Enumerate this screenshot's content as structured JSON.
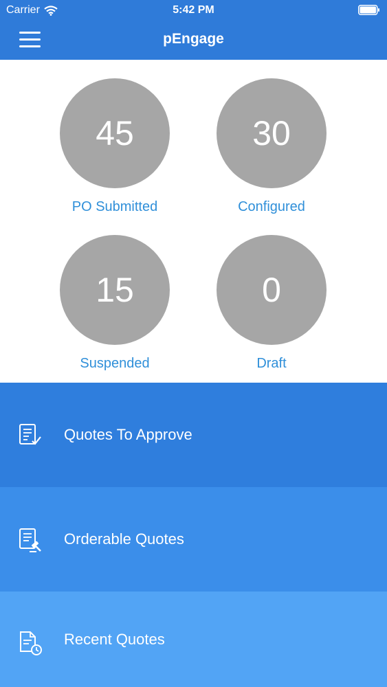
{
  "status_bar": {
    "carrier": "Carrier",
    "time": "5:42 PM"
  },
  "header": {
    "title": "pEngage"
  },
  "stats": [
    {
      "value": "45",
      "label": "PO Submitted"
    },
    {
      "value": "30",
      "label": "Configured"
    },
    {
      "value": "15",
      "label": "Suspended"
    },
    {
      "value": "0",
      "label": "Draft"
    }
  ],
  "menu": [
    {
      "label": "Quotes To Approve",
      "icon": "document-check-icon"
    },
    {
      "label": "Orderable Quotes",
      "icon": "document-gavel-icon"
    },
    {
      "label": "Recent Quotes",
      "icon": "document-clock-icon"
    }
  ],
  "colors": {
    "header": "#2F7BD9",
    "stat_circle": "#A6A6A6",
    "stat_label": "#2F8FD9",
    "menu_1": "#2F7EDD",
    "menu_2": "#3B8EEA",
    "menu_3": "#52A4F5"
  }
}
